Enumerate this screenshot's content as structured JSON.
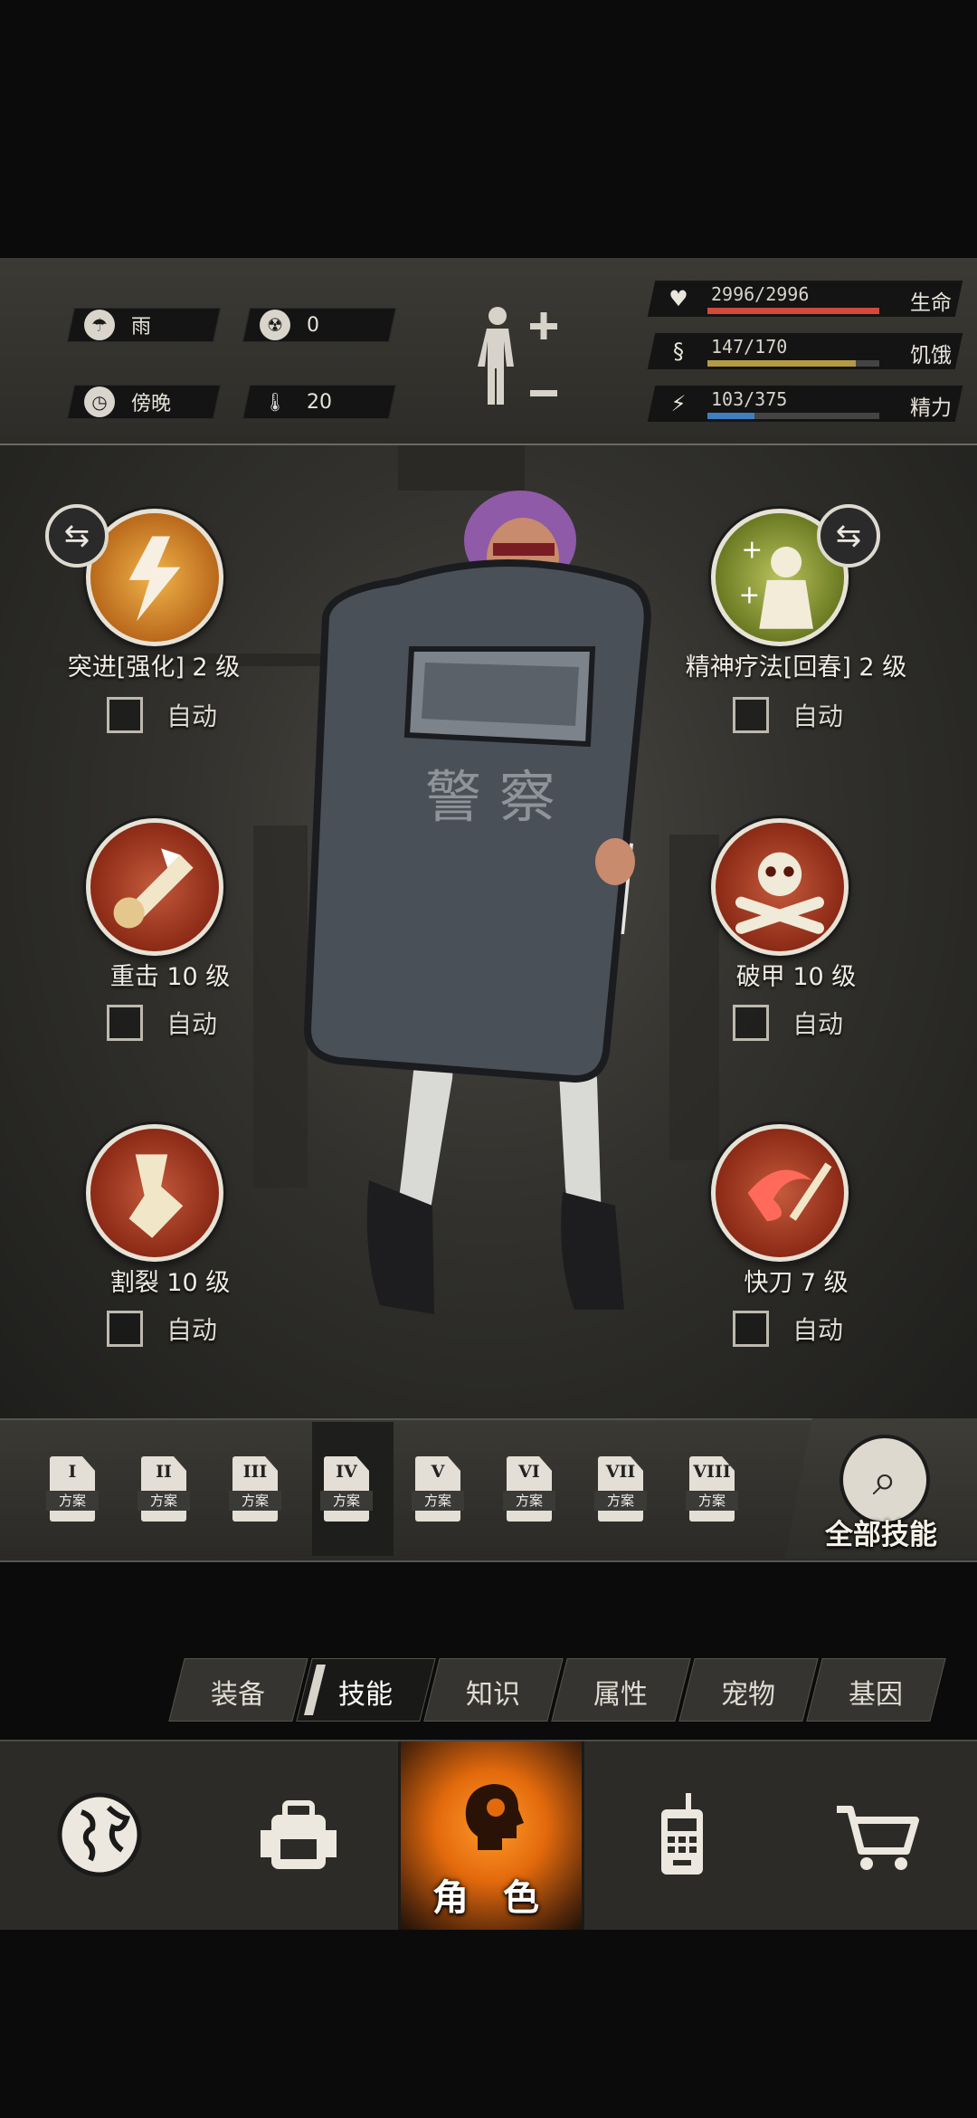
{
  "status": {
    "weather": {
      "icon": "rain-cloud-icon",
      "label": "雨"
    },
    "radiation": {
      "icon": "radiation-icon",
      "value": "0"
    },
    "time": {
      "icon": "clock-icon",
      "label": "傍晚"
    },
    "temperature": {
      "icon": "thermometer-icon",
      "value": "20"
    },
    "stats": [
      {
        "name": "生命",
        "value": "2996/2996",
        "fill": 1.0,
        "color": "#d24a3c",
        "icon": "heart-icon"
      },
      {
        "name": "饥饿",
        "value": "147/170",
        "fill": 0.865,
        "color": "#b59a45",
        "icon": "stomach-icon"
      },
      {
        "name": "精力",
        "value": "103/375",
        "fill": 0.275,
        "color": "#3f7fc0",
        "icon": "head-energy-icon"
      }
    ]
  },
  "skills": [
    {
      "label": "突进[强化] 2 级",
      "auto": "自动",
      "icon": "dash-skill-icon",
      "badge": "swap-icon"
    },
    {
      "label": "精神疗法[回春] 2 级",
      "auto": "自动",
      "icon": "mental-therapy-skill-icon",
      "badge": "swap-icon"
    },
    {
      "label": "重击 10 级",
      "auto": "自动",
      "icon": "heavy-strike-skill-icon"
    },
    {
      "label": "破甲 10 级",
      "auto": "自动",
      "icon": "armor-break-skill-icon"
    },
    {
      "label": "割裂 10 级",
      "auto": "自动",
      "icon": "rend-skill-icon"
    },
    {
      "label": "快刀 7 级",
      "auto": "自动",
      "icon": "quick-blade-skill-icon"
    }
  ],
  "plans": {
    "sub_label": "方案",
    "items": [
      "I",
      "II",
      "III",
      "IV",
      "V",
      "VI",
      "VII",
      "VIII"
    ],
    "active_index": 3
  },
  "all_skills_label": "全部技能",
  "subtabs": [
    {
      "label": "装备"
    },
    {
      "label": "技能",
      "active": true
    },
    {
      "label": "知识"
    },
    {
      "label": "属性"
    },
    {
      "label": "宠物"
    },
    {
      "label": "基因"
    }
  ],
  "nav": {
    "role_label": "角 色"
  },
  "shield_text": "警 察"
}
